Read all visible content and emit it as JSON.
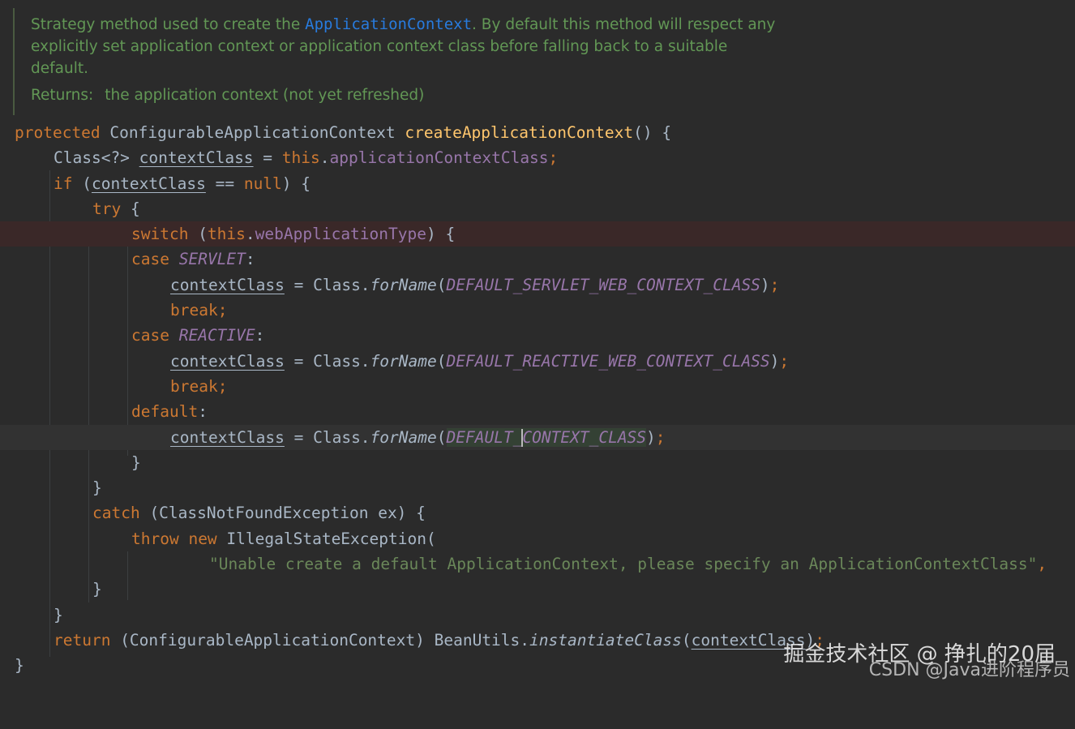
{
  "doc": {
    "text_before": "Strategy method used to create the ",
    "link": "ApplicationContext",
    "text_after": ". By default this method will respect any",
    "line2": "explicitly set application context or application context class before falling back to a suitable",
    "line3": "default.",
    "returns_tag": "Returns:",
    "returns_text": "the application context (not yet refreshed)"
  },
  "code": {
    "l1": {
      "protected": "protected",
      "type": "ConfigurableApplicationContext",
      "method": "createApplicationContext",
      "rest": "() {"
    },
    "l2": {
      "type": "Class<?> ",
      "var": "contextClass",
      "eq": " = ",
      "this": "this",
      "dot": ".",
      "field": "applicationContextClass",
      "semi": ";"
    },
    "l3": {
      "if": "if",
      "p1": " (",
      "var": "contextClass",
      "op": " == ",
      "null": "null",
      "p2": ") {"
    },
    "l4": {
      "try": "try",
      "brace": " {"
    },
    "l5": {
      "switch": "switch",
      "p1": " (",
      "this": "this",
      "dot": ".",
      "field": "webApplicationType",
      "p2": ") {"
    },
    "l6": {
      "case": "case",
      "sp": " ",
      "const": "SERVLET",
      "colon": ":"
    },
    "l7": {
      "var": "contextClass",
      "eq": " = Class.",
      "method": "forName",
      "p1": "(",
      "const": "DEFAULT_SERVLET_WEB_CONTEXT_CLASS",
      "p2": ")",
      "semi": ";"
    },
    "l8": {
      "break": "break",
      "semi": ";"
    },
    "l9": {
      "case": "case",
      "sp": " ",
      "const": "REACTIVE",
      "colon": ":"
    },
    "l10": {
      "var": "contextClass",
      "eq": " = Class.",
      "method": "forName",
      "p1": "(",
      "const": "DEFAULT_REACTIVE_WEB_CONTEXT_CLASS",
      "p2": ")",
      "semi": ";"
    },
    "l11": {
      "break": "break",
      "semi": ";"
    },
    "l12": {
      "default": "default",
      "colon": ":"
    },
    "l13": {
      "var": "contextClass",
      "eq": " = Class.",
      "method": "forName",
      "p1": "(",
      "const_a": "DEFAULT_",
      "const_b": "CONTEXT_CLASS",
      "p2": ")",
      "semi": ";"
    },
    "l14": {
      "brace": "}"
    },
    "l15": {
      "brace": "}"
    },
    "l16": {
      "catch": "catch",
      "rest": " (ClassNotFoundException ex) {"
    },
    "l17": {
      "throw": "throw",
      "sp": " ",
      "new": "new",
      "rest": " IllegalStateException("
    },
    "l18": {
      "str": "\"Unable create a default ApplicationContext, please specify an ApplicationContextClass\"",
      "comma": ","
    },
    "l19": {
      "brace": "}"
    },
    "l20": {
      "brace": "}"
    },
    "l21": {
      "return": "return",
      "p1": " (ConfigurableApplicationContext) BeanUtils.",
      "method": "instantiateClass",
      "p2": "(",
      "var": "contextClass",
      "p3": ")",
      "semi": ";"
    },
    "l22": {
      "brace": "}"
    }
  },
  "watermark": {
    "line1": "掘金技术社区 @ 挣扎的20届",
    "line2": "CSDN @Java进阶程序员"
  }
}
